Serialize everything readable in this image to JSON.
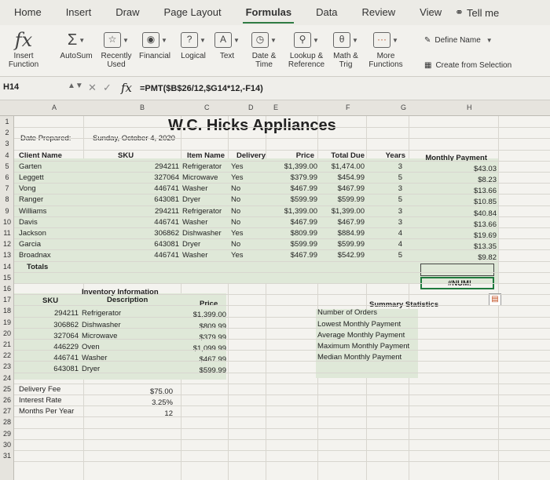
{
  "tabs": [
    "Home",
    "Insert",
    "Draw",
    "Page Layout",
    "Formulas",
    "Data",
    "Review",
    "View"
  ],
  "active_tab": "Formulas",
  "tell_me": "Tell me",
  "ribbon": {
    "insert_function": [
      "Insert",
      "Function"
    ],
    "autosum": "AutoSum",
    "recently_used": [
      "Recently",
      "Used"
    ],
    "financial": "Financial",
    "logical": "Logical",
    "text": "Text",
    "date_time": [
      "Date &",
      "Time"
    ],
    "lookup": [
      "Lookup &",
      "Reference"
    ],
    "math": [
      "Math &",
      "Trig"
    ],
    "more": [
      "More",
      "Functions"
    ],
    "define_name": "Define Name",
    "create_from_selection": "Create from Selection"
  },
  "formula_bar": {
    "name_box": "H14",
    "formula": "=PMT($B$26/12,$G14*12,-F14)"
  },
  "columns": [
    "A",
    "B",
    "C",
    "D",
    "E",
    "F",
    "G",
    "H"
  ],
  "rows": [
    "1",
    "2",
    "3",
    "4",
    "5",
    "6",
    "7",
    "8",
    "9",
    "10",
    "11",
    "12",
    "13",
    "14",
    "15",
    "16",
    "17",
    "18",
    "19",
    "20",
    "21",
    "22",
    "23",
    "24",
    "25",
    "26",
    "27",
    "28",
    "29",
    "30",
    "31"
  ],
  "sheet": {
    "title": "W.C. Hicks Appliances",
    "date_label": "Date Prepared:",
    "date_value": "Sunday, October 4, 2020",
    "headers": [
      "Client Name",
      "SKU",
      "Item Name",
      "Delivery",
      "Price",
      "Total Due",
      "Years",
      "Monthly Payment"
    ],
    "orders": [
      [
        "Garten",
        "294211",
        "Refrigerator",
        "Yes",
        "$1,399.00",
        "$1,474.00",
        "3",
        "$43.03"
      ],
      [
        "Leggett",
        "327064",
        "Microwave",
        "Yes",
        "$379.99",
        "$454.99",
        "5",
        "$8.23"
      ],
      [
        "Vong",
        "446741",
        "Washer",
        "No",
        "$467.99",
        "$467.99",
        "3",
        "$13.66"
      ],
      [
        "Ranger",
        "643081",
        "Dryer",
        "No",
        "$599.99",
        "$599.99",
        "5",
        "$10.85"
      ],
      [
        "Williams",
        "294211",
        "Refrigerator",
        "No",
        "$1,399.00",
        "$1,399.00",
        "3",
        "$40.84"
      ],
      [
        "Davis",
        "446741",
        "Washer",
        "No",
        "$467.99",
        "$467.99",
        "3",
        "$13.66"
      ],
      [
        "Jackson",
        "306862",
        "Dishwasher",
        "Yes",
        "$809.99",
        "$884.99",
        "4",
        "$19.69"
      ],
      [
        "Garcia",
        "643081",
        "Dryer",
        "No",
        "$599.99",
        "$599.99",
        "4",
        "$13.35"
      ],
      [
        "Broadnax",
        "446741",
        "Washer",
        "Yes",
        "$467.99",
        "$542.99",
        "5",
        "$9.82"
      ]
    ],
    "totals_label": "Totals",
    "totals_value": "#NUM!",
    "inventory_title": "Inventory Information",
    "inventory_headers": [
      "SKU",
      "Description",
      "Price"
    ],
    "inventory": [
      [
        "294211",
        "Refrigerator",
        "$1,399.00"
      ],
      [
        "306862",
        "Dishwasher",
        "$809.99"
      ],
      [
        "327064",
        "Microwave",
        "$379.99"
      ],
      [
        "446229",
        "Oven",
        "$1,099.99"
      ],
      [
        "446741",
        "Washer",
        "$467.99"
      ],
      [
        "643081",
        "Dryer",
        "$599.99"
      ]
    ],
    "params": [
      [
        "Delivery Fee",
        "$75.00"
      ],
      [
        "Interest Rate",
        "3.25%"
      ],
      [
        "Months Per Year",
        "12"
      ]
    ],
    "summary_title": "Summary Statistics",
    "summary": [
      "Number of Orders",
      "Lowest Monthly Payment",
      "Average Monthly Payment",
      "Maximum Monthly Payment",
      "Median Monthly Payment"
    ]
  }
}
